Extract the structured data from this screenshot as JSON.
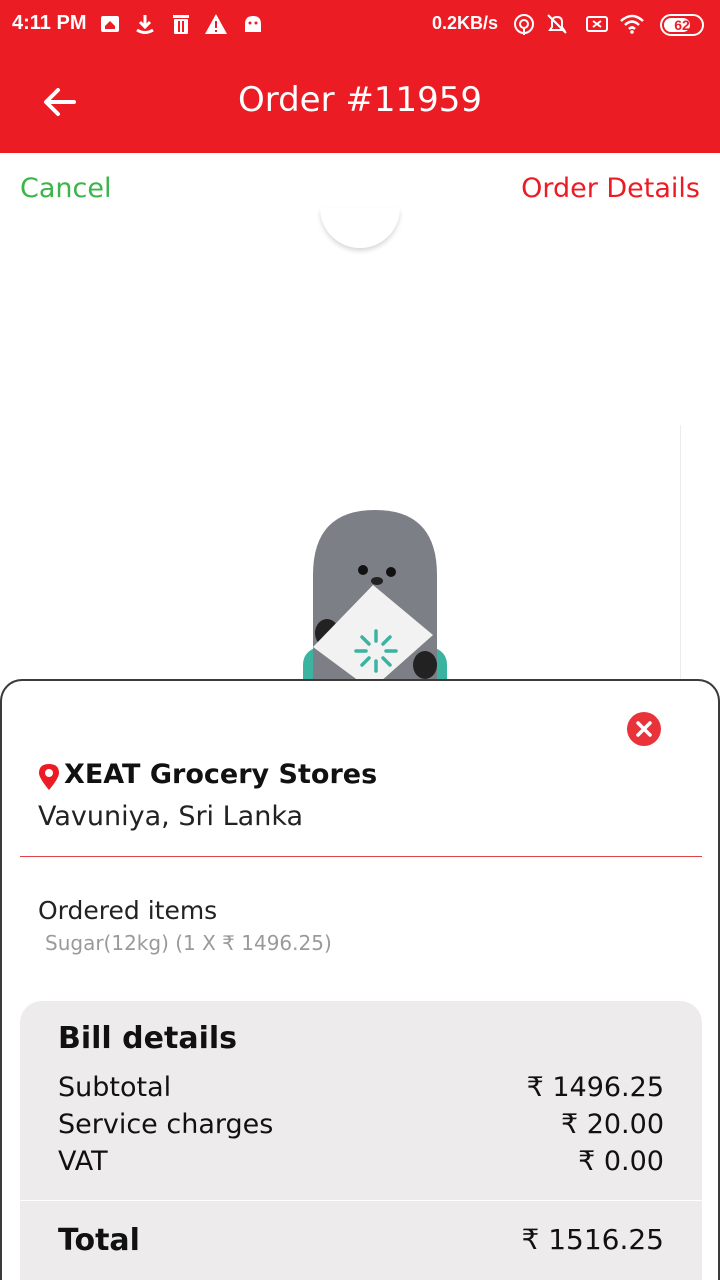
{
  "status_bar": {
    "time": "4:11 PM",
    "net_speed": "0.2KB/s",
    "battery": "62",
    "icons": [
      "home-notification-icon",
      "download-icon",
      "trash-icon",
      "warning-icon",
      "android-icon",
      "hotspot-icon",
      "bell-off-icon",
      "sim-off-icon",
      "wifi-icon",
      "battery-icon"
    ]
  },
  "app_bar": {
    "title": "Order #11959",
    "back_icon": "arrow-left-icon"
  },
  "actions": {
    "cancel_label": "Cancel",
    "details_label": "Order Details"
  },
  "sheet": {
    "close_icon": "close-circle-icon",
    "store_name": "XEAT Grocery Stores",
    "store_location": "Vavuniya, Sri Lanka",
    "ordered_items_title": "Ordered items",
    "items": [
      "Sugar(12kg) (1 X ₹ 1496.25)"
    ],
    "bill": {
      "heading": "Bill details",
      "subtotal_label": "Subtotal",
      "subtotal_value": "₹ 1496.25",
      "service_label": "Service charges",
      "service_value": "₹ 20.00",
      "vat_label": "VAT",
      "vat_value": "₹ 0.00",
      "total_label": "Total",
      "total_value": "₹ 1516.25"
    }
  },
  "colors": {
    "brand_red": "#ec1c24",
    "cancel_green": "#3bb54a",
    "bill_bg": "#edebec"
  }
}
